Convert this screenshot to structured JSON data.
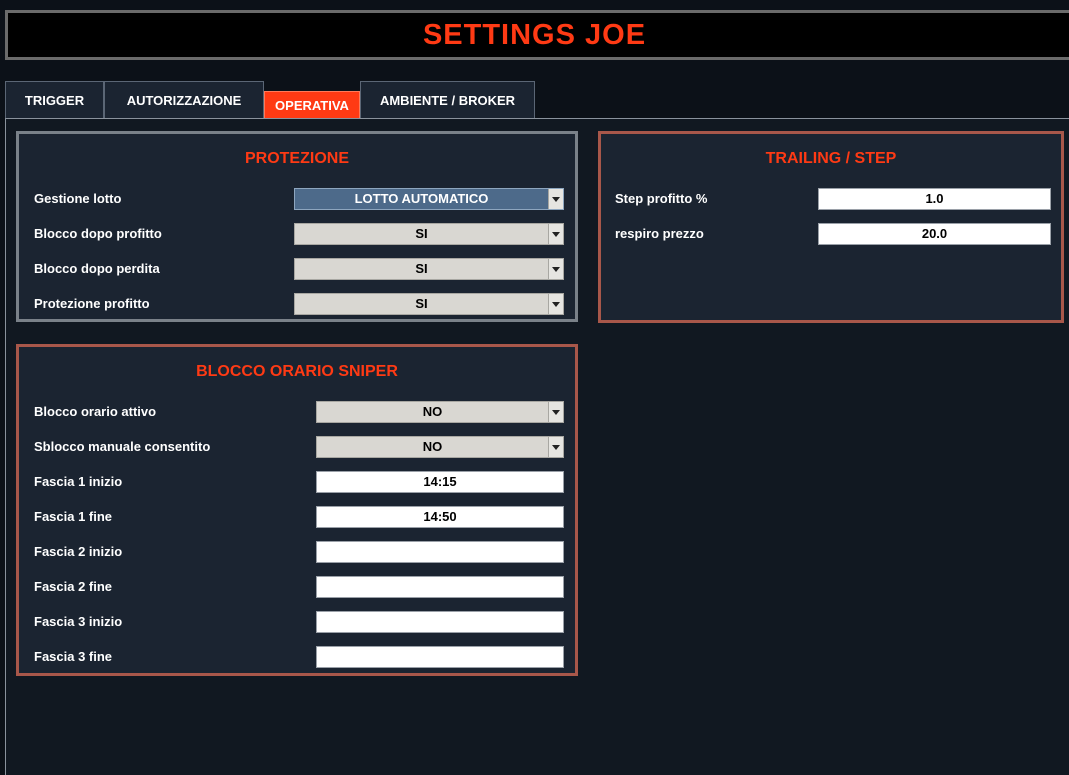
{
  "window": {
    "title": "SETTINGS JOE"
  },
  "tabs": [
    {
      "label": "TRIGGER",
      "active": false
    },
    {
      "label": "AUTORIZZAZIONE",
      "active": false
    },
    {
      "label": "OPERATIVA",
      "active": true
    },
    {
      "label": "AMBIENTE / BROKER",
      "active": false
    }
  ],
  "protezione": {
    "title": "PROTEZIONE",
    "rows": [
      {
        "label": "Gestione lotto",
        "value": "LOTTO AUTOMATICO"
      },
      {
        "label": "Blocco dopo profitto",
        "value": "SI"
      },
      {
        "label": "Blocco dopo perdita",
        "value": "SI"
      },
      {
        "label": "Protezione profitto",
        "value": "SI"
      }
    ]
  },
  "trailing": {
    "title": "TRAILING / STEP",
    "rows": [
      {
        "label": "Step profitto %",
        "value": "1.0"
      },
      {
        "label": "respiro prezzo",
        "value": "20.0"
      }
    ]
  },
  "blocco_orario": {
    "title": "BLOCCO ORARIO SNIPER",
    "rows": [
      {
        "label": "Blocco orario attivo",
        "value": "NO"
      },
      {
        "label": "Sblocco manuale consentito",
        "value": "NO"
      },
      {
        "label": "Fascia 1 inizio",
        "value": "14:15"
      },
      {
        "label": "Fascia 1 fine",
        "value": "14:50"
      },
      {
        "label": "Fascia 2 inizio",
        "value": ""
      },
      {
        "label": "Fascia 2 fine",
        "value": ""
      },
      {
        "label": "Fascia 3 inizio",
        "value": ""
      },
      {
        "label": "Fascia 3 fine",
        "value": ""
      }
    ]
  },
  "colors": {
    "accent": "#ff3a14",
    "background": "#0c1118",
    "panel": "#1b2431",
    "selected_combo": "#4d6a8a"
  },
  "icons": {
    "combo_arrow": "chevron-down-icon"
  }
}
